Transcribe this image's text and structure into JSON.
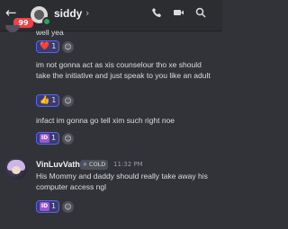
{
  "header": {
    "unread_badge": "99",
    "title": "siddy",
    "chevron": "›",
    "icons": [
      "back-arrow-icon",
      "voice-call-icon",
      "video-call-icon",
      "search-icon"
    ]
  },
  "messages": [
    {
      "text": "well yea",
      "reactions": [
        {
          "emoji": "❤️",
          "count": "1"
        }
      ]
    },
    {
      "text": "im not gonna act as xis counselour tho xe should take the initiative and just speak to you like an adult",
      "reactions": [
        {
          "emoji": "👍",
          "count": "1"
        }
      ]
    },
    {
      "text": "infact im gonna go tell xim such right noe",
      "reactions": [
        {
          "emoji": "ID",
          "count": "1"
        }
      ]
    }
  ],
  "second_author": {
    "username": "VinLuvVath",
    "tag": "COLD",
    "timestamp": "11:32 PM",
    "text": "His Mommy and daddy should really take away his computer access ngl",
    "reactions": [
      {
        "emoji": "ID",
        "count": "1"
      }
    ]
  },
  "colors": {
    "background": "#313338",
    "reaction_bg": "#3a3c70",
    "reaction_border": "#5865f2",
    "badge": "#f23f43"
  }
}
